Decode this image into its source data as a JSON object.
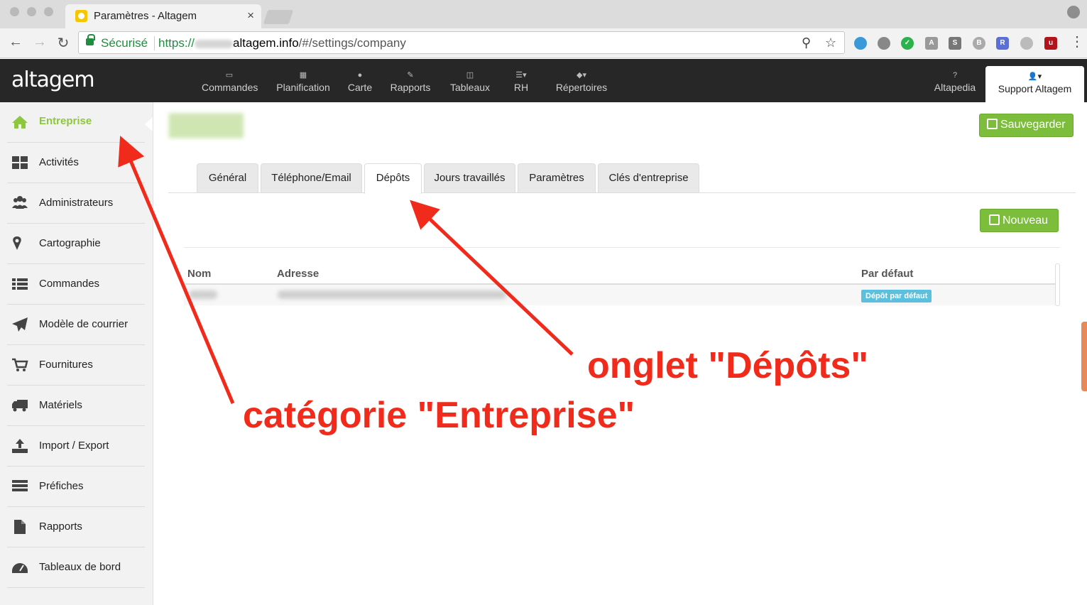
{
  "browser": {
    "tab_title": "Paramètres - Altagem",
    "tab_close": "×",
    "secure_label": "Sécurisé",
    "url_scheme": "https://",
    "url_host": "altagem.info",
    "url_path": "/#/settings/company"
  },
  "app": {
    "logo": "altagem",
    "nav": [
      {
        "label": "Commandes",
        "icon": "inbox-icon"
      },
      {
        "label": "Planification",
        "icon": "calendar-icon"
      },
      {
        "label": "Carte",
        "icon": "map-marker-icon"
      },
      {
        "label": "Rapports",
        "icon": "edit-icon"
      },
      {
        "label": "Tableaux",
        "icon": "columns-icon"
      },
      {
        "label": "RH",
        "icon": "list-icon"
      },
      {
        "label": "Répertoires",
        "icon": "cube-icon"
      }
    ],
    "help": {
      "label": "Altapedia",
      "icon": "question-icon"
    },
    "user": {
      "label": "Support Altagem",
      "icon": "user-icon"
    }
  },
  "sidebar": {
    "items": [
      {
        "label": "Entreprise",
        "icon": "home-icon",
        "active": true
      },
      {
        "label": "Activités",
        "icon": "th-large-icon"
      },
      {
        "label": "Administrateurs",
        "icon": "users-icon"
      },
      {
        "label": "Cartographie",
        "icon": "map-marker-icon"
      },
      {
        "label": "Commandes",
        "icon": "list-icon"
      },
      {
        "label": "Modèle de courrier",
        "icon": "paper-plane-icon"
      },
      {
        "label": "Fournitures",
        "icon": "shopping-cart-icon"
      },
      {
        "label": "Matériels",
        "icon": "truck-icon"
      },
      {
        "label": "Import / Export",
        "icon": "upload-icon"
      },
      {
        "label": "Préfiches",
        "icon": "tasks-icon"
      },
      {
        "label": "Rapports",
        "icon": "file-icon"
      },
      {
        "label": "Tableaux de bord",
        "icon": "dashboard-icon"
      }
    ]
  },
  "main": {
    "save_label": "Sauvegarder",
    "new_label": "Nouveau",
    "tabs": [
      {
        "label": "Général"
      },
      {
        "label": "Téléphone/Email"
      },
      {
        "label": "Dépôts",
        "active": true
      },
      {
        "label": "Jours travaillés"
      },
      {
        "label": "Paramètres"
      },
      {
        "label": "Clés d'entreprise"
      }
    ],
    "table": {
      "columns": [
        "Nom",
        "Adresse",
        "Par défaut"
      ],
      "rows": [
        {
          "default_badge": "Dépôt par défaut"
        }
      ]
    }
  },
  "annotations": {
    "tab_callout": "onglet \"Dépôts\"",
    "category_callout": "catégorie \"Entreprise\"",
    "color": "#f12b1b"
  },
  "colors": {
    "brand_green": "#8dc63f",
    "button_green": "#7cbd3b",
    "header_dark": "#272727",
    "badge_blue": "#5bc0de"
  }
}
